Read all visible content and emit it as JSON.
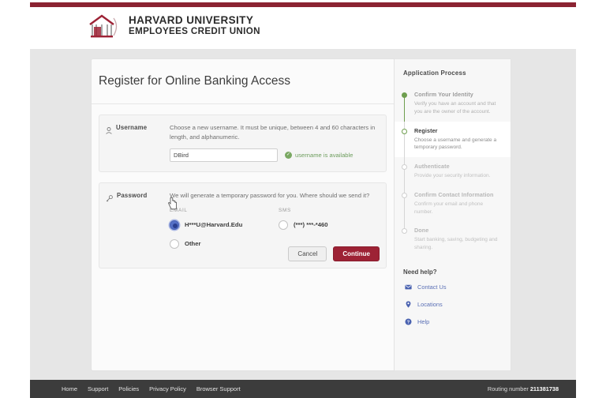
{
  "brand": {
    "line1": "HARVARD UNIVERSITY",
    "line2": "EMPLOYEES CREDIT UNION",
    "logo_icon": "bank-building-icon",
    "accent_color": "#8b2332"
  },
  "card": {
    "title": "Register for Online Banking Access"
  },
  "username_section": {
    "icon": "person-icon",
    "label": "Username",
    "description": "Choose a new username. It must be unique, between 4 and 60 characters in length, and alphanumeric.",
    "input_value": "DBird",
    "input_placeholder": "",
    "availability_text": "username is available",
    "availability_icon": "check-circle-icon",
    "availability_color": "#6e9e5e"
  },
  "password_section": {
    "icon": "key-icon",
    "label": "Password",
    "description": "We will generate a temporary password for you. Where should we send it?",
    "email_column_header": "EMAIL",
    "sms_column_header": "SMS",
    "options": [
      {
        "id": "email",
        "label": "H***U@Harvard.Edu",
        "selected": true
      },
      {
        "id": "sms",
        "label": "(***) ***-*460",
        "selected": false
      },
      {
        "id": "other",
        "label": "Other",
        "selected": false
      }
    ]
  },
  "actions": {
    "cancel_label": "Cancel",
    "continue_label": "Continue",
    "continue_color": "#9d2235"
  },
  "sidebar": {
    "title": "Application Process",
    "steps": [
      {
        "name": "Confirm Your Identity",
        "desc": "Verify you have an account and that you are the owner of the account.",
        "state": "done"
      },
      {
        "name": "Register",
        "desc": "Choose a username and generate a temporary password.",
        "state": "active"
      },
      {
        "name": "Authenticate",
        "desc": "Provide your security information.",
        "state": "pending"
      },
      {
        "name": "Confirm Contact Information",
        "desc": "Confirm your email and phone number.",
        "state": "pending"
      },
      {
        "name": "Done",
        "desc": "Start banking, saving, budgeting and sharing.",
        "state": "pending"
      }
    ],
    "help_title": "Need help?",
    "help_links": [
      {
        "label": "Contact Us",
        "icon": "envelope-icon"
      },
      {
        "label": "Locations",
        "icon": "map-pin-icon"
      },
      {
        "label": "Help",
        "icon": "question-circle-icon"
      }
    ],
    "link_color": "#5a6fb5"
  },
  "footer": {
    "links": [
      "Home",
      "Support",
      "Policies",
      "Privacy Policy",
      "Browser Support"
    ],
    "routing_label": "Routing number",
    "routing_number": "211381738"
  }
}
